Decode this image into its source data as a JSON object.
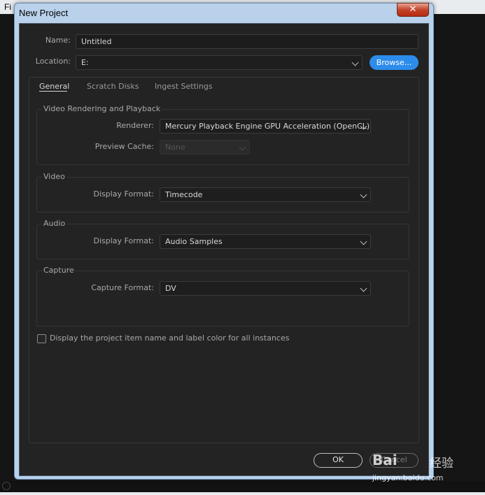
{
  "background": {
    "left_text": "Fi"
  },
  "window": {
    "title": "New Project",
    "close_label": "✕"
  },
  "form": {
    "name_label": "Name:",
    "name_value": "Untitled",
    "location_label": "Location:",
    "location_value": "E:",
    "browse_label": "Browse..."
  },
  "tabs": [
    {
      "label": "General",
      "active": true
    },
    {
      "label": "Scratch Disks",
      "active": false
    },
    {
      "label": "Ingest Settings",
      "active": false
    }
  ],
  "video_rendering": {
    "title": "Video Rendering and Playback",
    "renderer_label": "Renderer:",
    "renderer_value": "Mercury Playback Engine GPU Acceleration (OpenCL)",
    "preview_cache_label": "Preview Cache:",
    "preview_cache_value": "None"
  },
  "video": {
    "title": "Video",
    "display_format_label": "Display Format:",
    "display_format_value": "Timecode"
  },
  "audio": {
    "title": "Audio",
    "display_format_label": "Display Format:",
    "display_format_value": "Audio Samples"
  },
  "capture": {
    "title": "Capture",
    "capture_format_label": "Capture Format:",
    "capture_format_value": "DV"
  },
  "checkbox": {
    "label": "Display the project item name and label color for all instances",
    "checked": false
  },
  "buttons": {
    "ok_label": "OK",
    "cancel_label": "Cancel"
  },
  "watermark": {
    "brand": "Bai",
    "brand_suffix": "经验",
    "url": "jingyan.baidu.com"
  },
  "colors": {
    "accent": "#2d8ceb",
    "panel_bg": "#232323"
  }
}
